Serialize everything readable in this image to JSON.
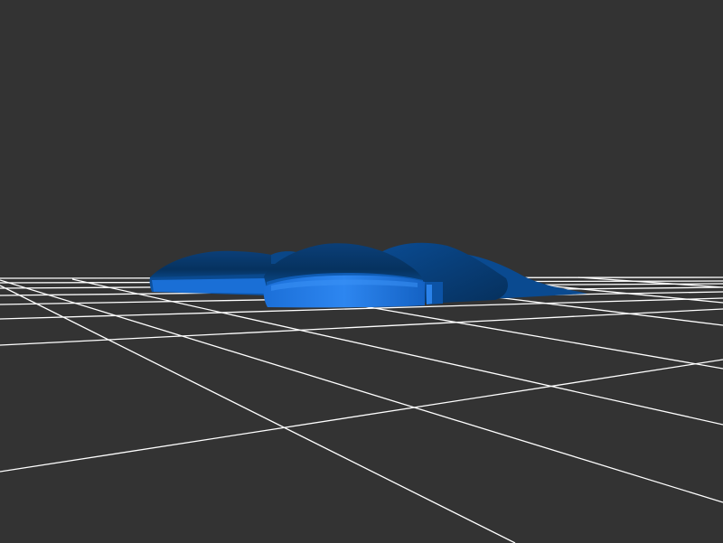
{
  "scene": {
    "background_color": "#333333",
    "grid_color": "#ffffff",
    "model_colors": {
      "dark": "#06325f",
      "mid": "#0a4c93",
      "base": "#1463c2",
      "light": "#2d86f0"
    }
  }
}
